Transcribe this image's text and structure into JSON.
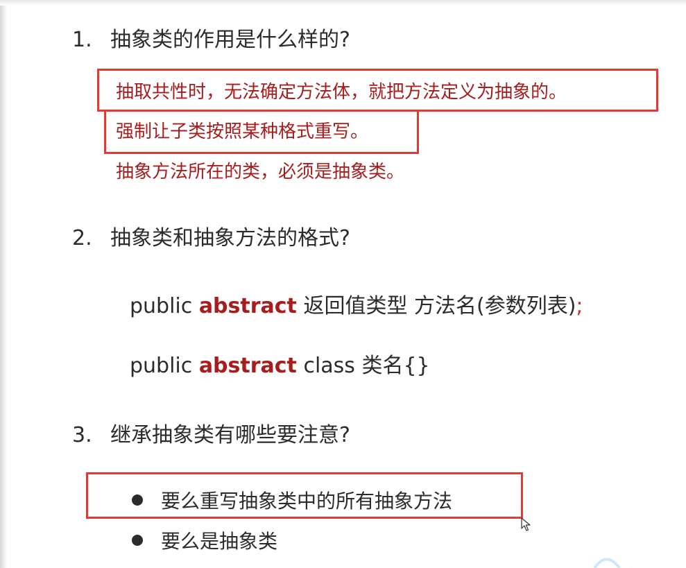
{
  "q1": {
    "number": "1.",
    "title": "抽象类的作用是什么样的?",
    "answers": [
      "抽取共性时，无法确定方法体，就把方法定义为抽象的。",
      "强制让子类按照某种格式重写。",
      "抽象方法所在的类，必须是抽象类。"
    ]
  },
  "q2": {
    "number": "2.",
    "title": "抽象类和抽象方法的格式?",
    "method_line": {
      "modifier": "public",
      "keyword": "abstract",
      "rest": "返回值类型 方法名(参数列表)",
      "semicolon": ";"
    },
    "class_line": {
      "modifier": "public",
      "keyword": "abstract",
      "rest": "class 类名{}"
    }
  },
  "q3": {
    "number": "3.",
    "title": "继承抽象类有哪些要注意?",
    "bullets": [
      "要么重写抽象类中的所有抽象方法",
      "要么是抽象类"
    ]
  },
  "colors": {
    "answer_red": "#a71d1d",
    "highlight_box": "#e53935",
    "text": "#2b2b2b"
  },
  "icons": {
    "cursor": "mouse-pointer-icon",
    "bullet": "bullet-dot-icon"
  }
}
